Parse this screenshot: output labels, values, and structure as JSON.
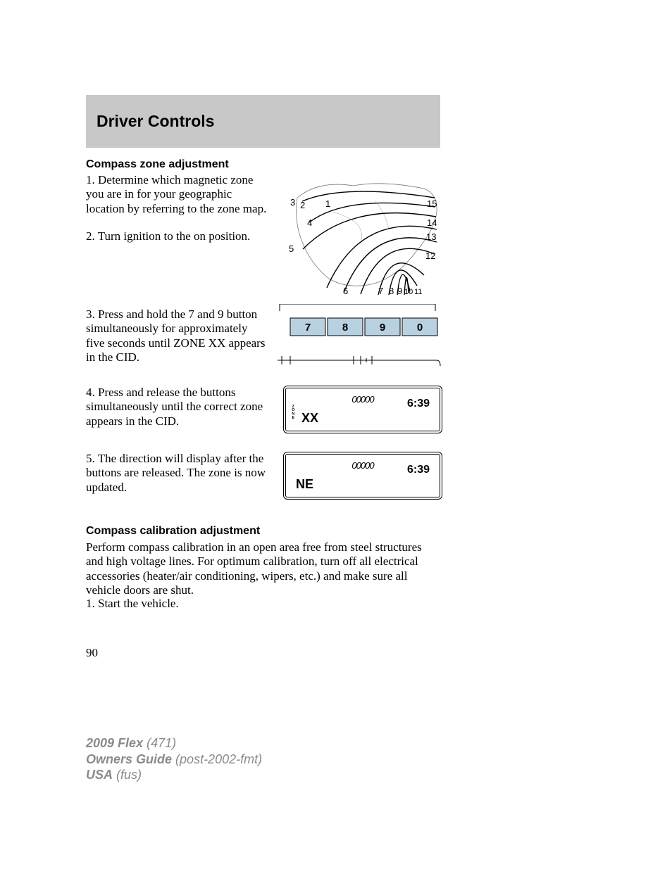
{
  "header": {
    "title": "Driver Controls"
  },
  "section1": {
    "heading": "Compass zone adjustment",
    "p1": "1. Determine which magnetic zone you are in for your geographic location by referring to the zone map.",
    "p2": "2. Turn ignition to the on position.",
    "p3": "3. Press and hold the 7 and 9 button simultaneously for approximately five seconds until ZONE XX appears in the CID.",
    "p4": "4. Press and release the buttons simultaneously until the correct zone appears in the CID.",
    "p5": "5. The direction will display after the buttons are released. The zone is now updated."
  },
  "section2": {
    "heading": "Compass calibration adjustment",
    "p1": "Perform compass calibration in an open area free from steel structures and high voltage lines. For optimum calibration, turn off all electrical accessories (heater/air conditioning, wipers, etc.) and make sure all vehicle doors are shut.",
    "p2": "1. Start the vehicle."
  },
  "zonemap": {
    "numbers": [
      "1",
      "2",
      "3",
      "4",
      "5",
      "6",
      "7",
      "8",
      "9",
      "10",
      "11",
      "12",
      "13",
      "14",
      "15"
    ]
  },
  "keypad": {
    "keys": [
      "7",
      "8",
      "9",
      "0"
    ]
  },
  "cid1": {
    "ooo": "00000",
    "time": "6:39",
    "zone_lbl": "ZONE",
    "main": "XX"
  },
  "cid2": {
    "ooo": "00000",
    "time": "6:39",
    "main": "NE"
  },
  "page_number": "90",
  "footer": {
    "model_b": "2009 Flex",
    "model_i": "(471)",
    "line2_b": "Owners Guide",
    "line2_i": "(post-2002-fmt)",
    "line3_b": "USA",
    "line3_i": "(fus)"
  }
}
